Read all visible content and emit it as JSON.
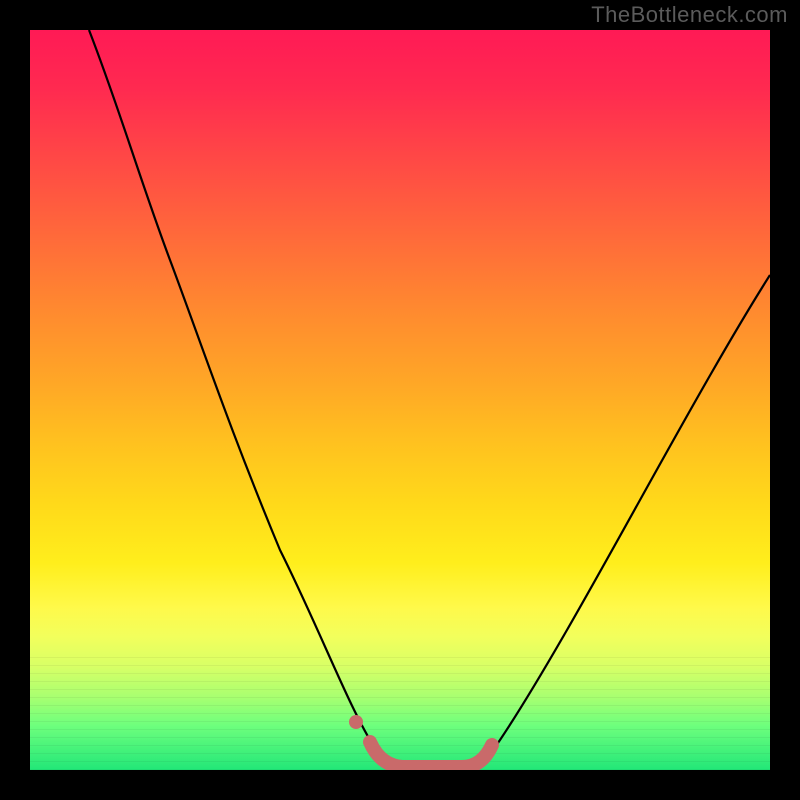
{
  "watermark": "TheBottleneck.com",
  "chart_data": {
    "type": "line",
    "title": "",
    "xlabel": "",
    "ylabel": "",
    "xlim": [
      0,
      100
    ],
    "ylim": [
      0,
      100
    ],
    "annotations": [],
    "series": [
      {
        "name": "bottleneck-curve",
        "x": [
          8,
          12,
          16,
          20,
          24,
          28,
          32,
          36,
          40,
          44,
          46,
          48,
          50,
          52,
          54,
          56,
          58,
          60,
          64,
          68,
          72,
          76,
          80,
          84,
          88,
          92,
          96,
          100
        ],
        "values": [
          100,
          90,
          80,
          71,
          62,
          53,
          45,
          37,
          29,
          22,
          15,
          8,
          3,
          0,
          0,
          0,
          0,
          3,
          9,
          16,
          23,
          30,
          37,
          44,
          50,
          56,
          62,
          67
        ]
      },
      {
        "name": "optimal-band-marker",
        "x": [
          48,
          50,
          52,
          54,
          56,
          58,
          60
        ],
        "values": [
          3,
          1,
          0,
          0,
          0,
          1,
          3
        ]
      }
    ],
    "colors": {
      "curve": "#000000",
      "marker": "#c96a6a",
      "gradient_top": "#ff1a55",
      "gradient_bottom": "#22e778"
    }
  }
}
